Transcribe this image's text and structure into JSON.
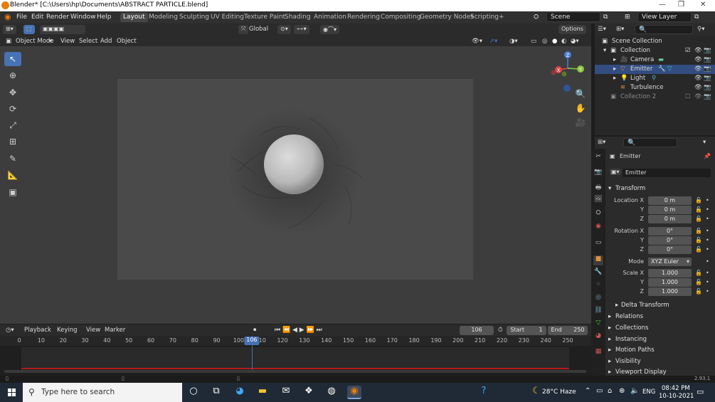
{
  "window": {
    "title": "Blender* [C:\\Users\\hp\\Documents\\ABSTRACT PARTICLE.blend]",
    "controls": [
      "—",
      "❐",
      "✕"
    ]
  },
  "menu": {
    "items": [
      "File",
      "Edit",
      "Render",
      "Window",
      "Help"
    ],
    "workspaces": [
      "Layout",
      "Modeling",
      "Sculpting",
      "UV Editing",
      "Texture Paint",
      "Shading",
      "Animation",
      "Rendering",
      "Compositing",
      "Geometry Nodes",
      "Scripting"
    ],
    "active_workspace": "Layout",
    "add_tab": "+",
    "scene": "Scene",
    "view_layer": "View Layer"
  },
  "viewport_header": {
    "orientation": "Global",
    "options_label": "Options",
    "mode": "Object Mode",
    "menus": [
      "View",
      "Select",
      "Add",
      "Object"
    ]
  },
  "gizmo": {
    "x": "X",
    "y": "Y",
    "z": "Z"
  },
  "timeline": {
    "menus": [
      "Playback",
      "Keying",
      "View",
      "Marker"
    ],
    "current_frame": "106",
    "start_label": "Start",
    "start": "1",
    "end_label": "End",
    "end": "250",
    "ticks": [
      "0",
      "10",
      "20",
      "30",
      "40",
      "50",
      "60",
      "70",
      "80",
      "90",
      "100",
      "106",
      "110",
      "120",
      "130",
      "140",
      "150",
      "160",
      "170",
      "180",
      "190",
      "200",
      "210",
      "220",
      "230",
      "240",
      "250"
    ]
  },
  "outliner": {
    "scene_collection": "Scene Collection",
    "items": [
      {
        "label": "Collection",
        "depth": 1
      },
      {
        "label": "Camera",
        "depth": 2
      },
      {
        "label": "Emitter",
        "depth": 2,
        "selected": true
      },
      {
        "label": "Light",
        "depth": 2
      },
      {
        "label": "Turbulence",
        "depth": 2
      },
      {
        "label": "Collection 2",
        "depth": 1
      }
    ]
  },
  "properties": {
    "object_name": "Emitter",
    "datablock_name": "Emitter",
    "transform_title": "Transform",
    "location": {
      "label": "Location X",
      "x": "0 m",
      "y": "0 m",
      "z": "0 m"
    },
    "rotation": {
      "label": "Rotation X",
      "x": "0°",
      "y": "0°",
      "z": "0°"
    },
    "mode_label": "Mode",
    "mode_value": "XYZ Euler",
    "scale": {
      "label": "Scale X",
      "x": "1.000",
      "y": "1.000",
      "z": "1.000"
    },
    "axis_y": "Y",
    "axis_z": "Z",
    "delta_transform": "Delta Transform",
    "panels": [
      "Relations",
      "Collections",
      "Instancing",
      "Motion Paths",
      "Visibility",
      "Viewport Display"
    ]
  },
  "statusbar": {
    "version": "2.93.1"
  },
  "taskbar": {
    "search_placeholder": "Type here to search",
    "weather": "28°C  Haze",
    "language": "ENG",
    "time": "08:42 PM",
    "date": "10-10-2021"
  },
  "colors": {
    "accent": "#4772b3",
    "selection": "#334d80",
    "range_line": "#b21d1d",
    "blender_orange": "#e87d0d"
  }
}
